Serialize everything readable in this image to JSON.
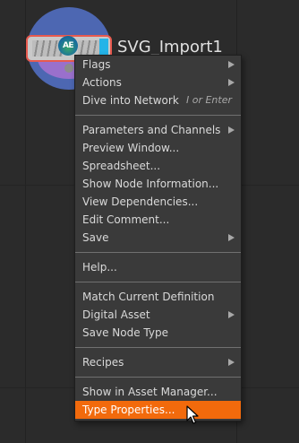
{
  "node": {
    "name": "SVG_Import1",
    "badge": "AE"
  },
  "context_menu": {
    "groups": [
      [
        {
          "label": "Flags",
          "submenu": true
        },
        {
          "label": "Actions",
          "submenu": true
        },
        {
          "label": "Dive into Network",
          "shortcut": "I or Enter"
        }
      ],
      [
        {
          "label": "Parameters and Channels",
          "submenu": true
        },
        {
          "label": "Preview Window..."
        },
        {
          "label": "Spreadsheet..."
        },
        {
          "label": "Show Node Information..."
        },
        {
          "label": "View Dependencies..."
        },
        {
          "label": "Edit Comment..."
        },
        {
          "label": "Save",
          "submenu": true
        }
      ],
      [
        {
          "label": "Help..."
        }
      ],
      [
        {
          "label": "Match Current Definition"
        },
        {
          "label": "Digital Asset",
          "submenu": true
        },
        {
          "label": "Save Node Type"
        }
      ],
      [
        {
          "label": "Recipes",
          "submenu": true
        }
      ],
      [
        {
          "label": "Show in Asset Manager..."
        },
        {
          "label": "Type Properties...",
          "highlighted": true
        }
      ]
    ]
  },
  "colors": {
    "background": "#2b2b2b",
    "menu_background": "#3a3a3a",
    "highlight": "#f26a0c",
    "node_selection_outline": "#e85a4f",
    "node_ring": "#4d67b2"
  }
}
